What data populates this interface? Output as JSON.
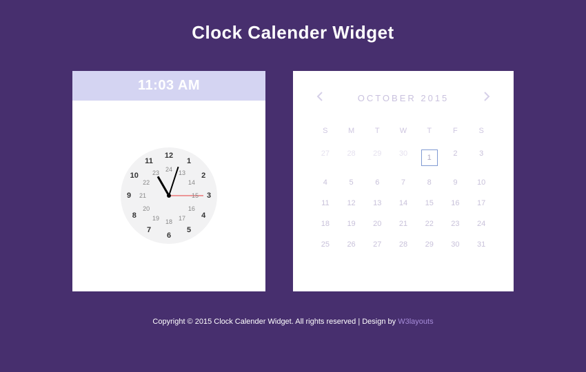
{
  "page_title": "Clock Calender Widget",
  "clock": {
    "time": "11:03 AM",
    "hours_outer": [
      "12",
      "1",
      "2",
      "3",
      "4",
      "5",
      "6",
      "7",
      "8",
      "9",
      "10",
      "11"
    ],
    "hours_inner": [
      "24",
      "13",
      "14",
      "15",
      "16",
      "17",
      "18",
      "19",
      "20",
      "21",
      "22",
      "23"
    ]
  },
  "calendar": {
    "month_label": "OCTOBER 2015",
    "dow": [
      "S",
      "M",
      "T",
      "W",
      "T",
      "F",
      "S"
    ],
    "days": [
      {
        "n": "27",
        "muted": true
      },
      {
        "n": "28",
        "muted": true
      },
      {
        "n": "29",
        "muted": true
      },
      {
        "n": "30",
        "muted": true
      },
      {
        "n": "1",
        "today": true
      },
      {
        "n": "2"
      },
      {
        "n": "3"
      },
      {
        "n": "4"
      },
      {
        "n": "5"
      },
      {
        "n": "6"
      },
      {
        "n": "7"
      },
      {
        "n": "8"
      },
      {
        "n": "9"
      },
      {
        "n": "10"
      },
      {
        "n": "11"
      },
      {
        "n": "12"
      },
      {
        "n": "13"
      },
      {
        "n": "14"
      },
      {
        "n": "15"
      },
      {
        "n": "16"
      },
      {
        "n": "17"
      },
      {
        "n": "18"
      },
      {
        "n": "19"
      },
      {
        "n": "20"
      },
      {
        "n": "21"
      },
      {
        "n": "22"
      },
      {
        "n": "23"
      },
      {
        "n": "24"
      },
      {
        "n": "25"
      },
      {
        "n": "26"
      },
      {
        "n": "27"
      },
      {
        "n": "28"
      },
      {
        "n": "29"
      },
      {
        "n": "30"
      },
      {
        "n": "31"
      }
    ]
  },
  "footer": {
    "copyright": "Copyright © 2015 Clock Calender Widget. All rights reserved | Design by ",
    "link_text": "W3layouts"
  }
}
